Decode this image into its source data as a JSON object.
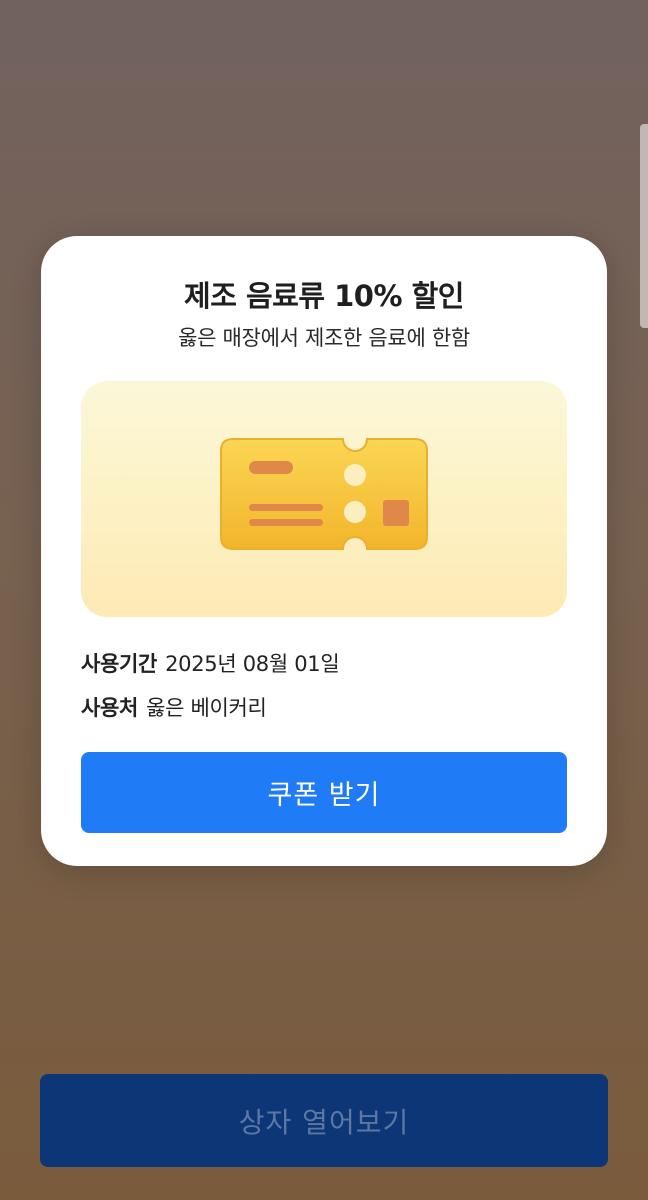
{
  "coupon": {
    "title": "제조 음료류 10% 할인",
    "subtitle": "옳은 매장에서 제조한 음료에 한함",
    "image_icon": "ticket-icon",
    "period_label": "사용기간",
    "period_value": "2025년 08월 01일",
    "place_label": "사용처",
    "place_value": "옳은 베이커리",
    "button_label": "쿠폰 받기"
  },
  "footer": {
    "button_label": "상자 열어보기"
  },
  "colors": {
    "primary_button": "#1f7cf6",
    "disabled_button": "#0d3677",
    "ticket": "#f7c637",
    "ticket_accent": "#e0884a"
  }
}
